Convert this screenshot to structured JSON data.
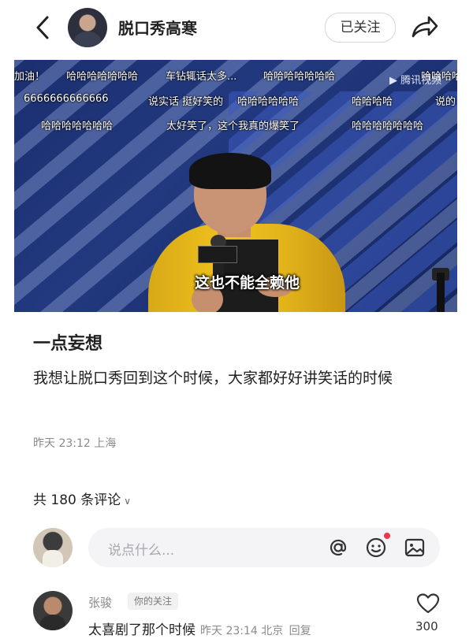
{
  "header": {
    "author_name": "脱口秀高寒",
    "follow_label": "已关注"
  },
  "video": {
    "danmaku": [
      "加油！",
      "哈哈哈哈哈哈哈",
      "车钻辄话太多...",
      "哈哈哈哈哈哈哈",
      "哈哈哈哈",
      "6666666666666",
      "说实话 挺好笑的",
      "哈哈哈哈哈哈",
      "哈哈哈哈",
      "说的",
      "哈哈哈哈哈哈哈",
      "太好笑了，这个我真的爆笑了",
      "哈哈哈哈哈哈哈"
    ],
    "watermark": "腾讯视频",
    "subtitle": "这也不能全赖他"
  },
  "post": {
    "title": "一点妄想",
    "body": "我想让脱口秀回到这个时候，大家都好好讲笑话的时候",
    "meta": "昨天 23:12 上海"
  },
  "comments": {
    "count_label": "共 180 条评论",
    "input_placeholder": "说点什么...",
    "items": [
      {
        "name": "张骏",
        "badge": "你的关注",
        "text": "太喜剧了那个时候",
        "meta": "昨天 23:14 北京",
        "reply_label": "回复",
        "likes": "300"
      }
    ]
  },
  "icons": {
    "back": "back-arrow-icon",
    "share": "share-icon",
    "at": "at-mention-icon",
    "emoji": "emoji-icon",
    "image": "image-icon",
    "heart": "heart-icon",
    "chevron": "chevron-down-icon"
  },
  "colors": {
    "notification_dot": "#f2344b",
    "jacket": "#f0c21c",
    "stage_blue": "#1b2f70"
  }
}
